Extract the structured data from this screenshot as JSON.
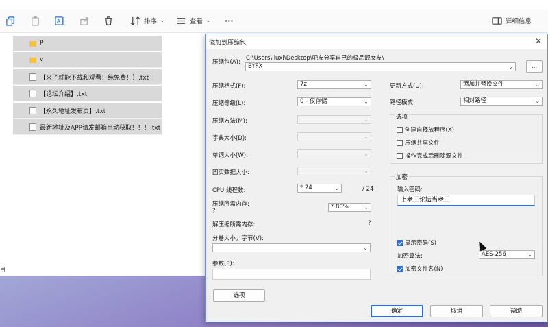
{
  "toolbar": {
    "sort_label": "排序",
    "view_label": "查看",
    "more_label": "···",
    "details_label": "详细信息"
  },
  "files": [
    {
      "name": "P",
      "type": "folder"
    },
    {
      "name": "v",
      "type": "folder"
    },
    {
      "name": "【来了就能下载和观看！纯免费！】.txt",
      "type": "txt"
    },
    {
      "name": "【论坛介绍】.txt",
      "type": "txt"
    },
    {
      "name": "【永久地址发布页】.txt",
      "type": "txt"
    },
    {
      "name": "最新地址及APP请发邮箱自动获取！！！.txt",
      "type": "txt"
    }
  ],
  "status_text": "目",
  "dialog": {
    "title": "添加到压缩包",
    "archive_label": "压缩包(A):",
    "archive_path": "C:\\Users\\liuxi\\Desktop\\吧友分享自己的极品靓女友\\",
    "archive_name": "BYFX",
    "browse_label": "...",
    "format_label": "压缩格式(F):",
    "format_value": "7z",
    "level_label": "压缩等级(L):",
    "level_value": "0 - 仅存储",
    "method_label": "压缩方法(M):",
    "dict_label": "字典大小(D):",
    "word_label": "单词大小(W):",
    "solid_label": "固实数据大小:",
    "threads_label": "CPU 线程数:",
    "threads_value": "* 24",
    "threads_total": "/ 24",
    "mem_comp_label": "压缩所需内存:",
    "mem_comp_value": "?",
    "mem_percent": "* 80%",
    "mem_decomp_label": "解压缩所需内存:",
    "mem_decomp_value": "?",
    "split_label": "分卷大小，字节(V):",
    "params_label": "参数(P):",
    "options_button": "选项",
    "update_label": "更新方式(U):",
    "update_value": "添加并替换文件",
    "path_mode_label": "路径模式",
    "path_mode_value": "相对路径",
    "options_group": "选项",
    "opt_sfx": "创建自释放程序(X)",
    "opt_shared": "压缩共享文件",
    "opt_delete": "操作完成后删除源文件",
    "encrypt_group": "加密",
    "password_label": "输入密码:",
    "password_value": "上老王论坛当老王",
    "show_password": "显示密码(S)",
    "enc_method_label": "加密算法:",
    "enc_method_value": "AES-256",
    "encrypt_names": "加密文件名(N)",
    "ok_button": "确定",
    "cancel_button": "取消",
    "help_button": "帮助"
  },
  "colors": {
    "accent": "#2a6fd6",
    "selection": "#d9d9d9",
    "folder": "#f5c242"
  }
}
